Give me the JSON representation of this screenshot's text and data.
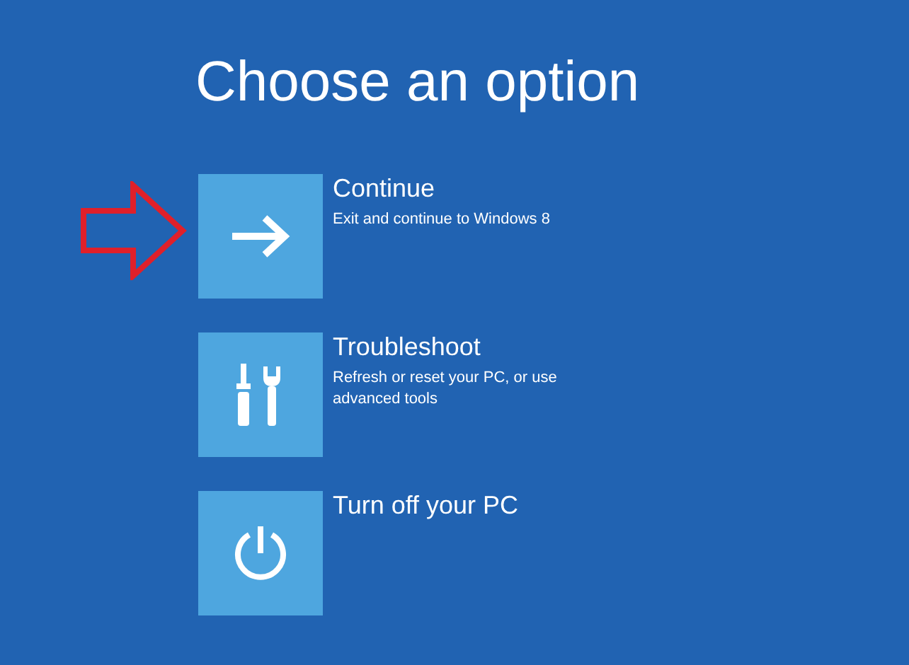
{
  "title": "Choose an option",
  "options": [
    {
      "kind": "continue",
      "label": "Continue",
      "description": "Exit and continue to Windows 8"
    },
    {
      "kind": "troubleshoot",
      "label": "Troubleshoot",
      "description": "Refresh or reset your PC, or use advanced tools"
    },
    {
      "kind": "power",
      "label": "Turn off your PC"
    }
  ],
  "annotation": {
    "kind": "arrow"
  }
}
